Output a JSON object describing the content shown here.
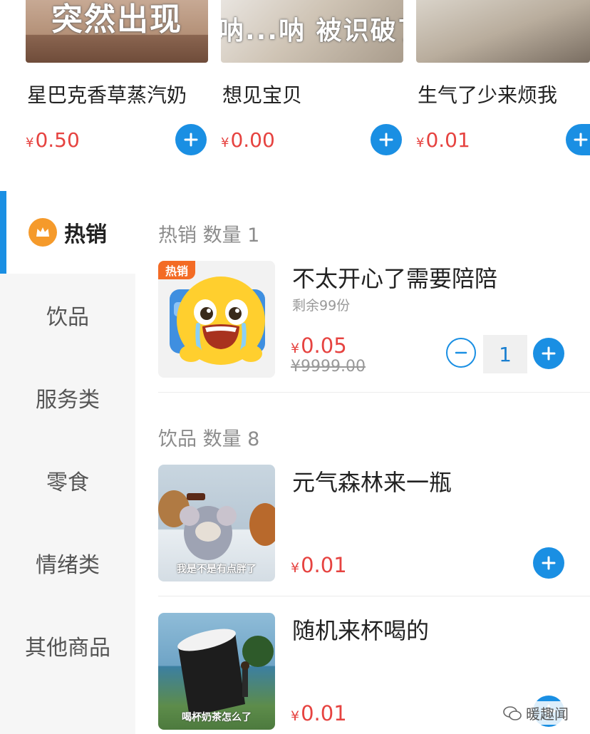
{
  "top_cards": [
    {
      "caption": "突然出现",
      "name": "星巴克香草蒸汽奶",
      "price": "0.50",
      "currency": "¥"
    },
    {
      "caption": "呐...呐 被识破了",
      "name": "想见宝贝",
      "price": "0.00",
      "currency": "¥"
    },
    {
      "caption": "",
      "name": "生气了少来烦我",
      "price": "0.01",
      "currency": "¥"
    }
  ],
  "sidebar": {
    "items": [
      {
        "label": "热销",
        "icon": "crown-icon",
        "active": true
      },
      {
        "label": "饮品"
      },
      {
        "label": "服务类"
      },
      {
        "label": "零食"
      },
      {
        "label": "情绪类"
      },
      {
        "label": "其他商品"
      }
    ]
  },
  "sections": [
    {
      "title": "热销 数量 1",
      "items": [
        {
          "name": "不太开心了需要陪陪",
          "tag": "热销",
          "stock": "剩余99份",
          "currency": "¥",
          "price": "0.05",
          "original_price": "¥9999.00",
          "quantity": "1"
        }
      ]
    },
    {
      "title": "饮品 数量 8",
      "items": [
        {
          "name": "元气森林来一瓶",
          "caption": "我是不是有点胖了",
          "currency": "¥",
          "price": "0.01"
        },
        {
          "name": "随机来杯喝的",
          "caption": "喝杯奶茶怎么了",
          "currency": "¥",
          "price": "0.01"
        }
      ]
    }
  ],
  "watermark": "暖趣闻",
  "colors": {
    "accent": "#1a8fe3",
    "price": "#e64340",
    "hot_tag": "#f36b25"
  }
}
